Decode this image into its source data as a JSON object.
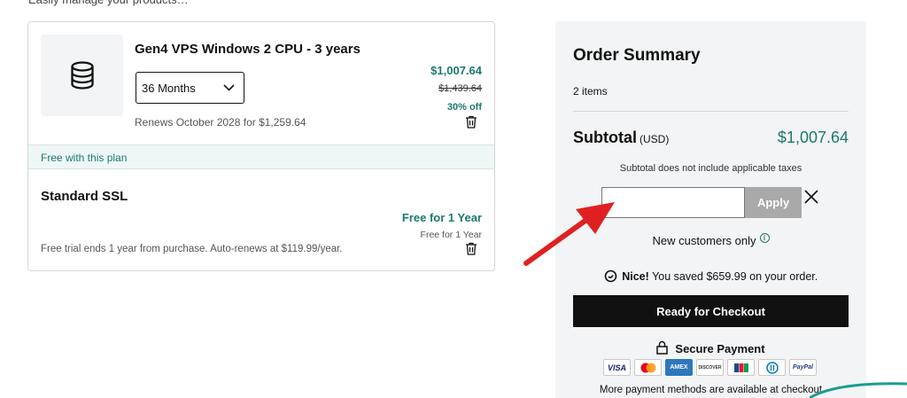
{
  "top_text": "ly … ig … p … … y p…",
  "cart": {
    "product_title": "Gen4 VPS Windows 2 CPU - 3 years",
    "term_value": "36 Months",
    "renews_text": "Renews October 2028 for $1,259.64",
    "price_now": "$1,007.64",
    "price_old": "$1,439.64",
    "discount": "30% off",
    "free_band": "Free with this plan",
    "ssl_title": "Standard SSL",
    "ssl_free": "Free for 1 Year",
    "ssl_free_sub": "Free for 1 Year",
    "ssl_trial": "Free trial ends 1 year from purchase. Auto-renews at $119.99/year."
  },
  "summary": {
    "title": "Order Summary",
    "items": "2 items",
    "subtotal_label": "Subtotal",
    "subtotal_currency": "(USD)",
    "subtotal_value": "$1,007.64",
    "tax_note": "Subtotal does not include applicable taxes",
    "promo_placeholder": "",
    "apply_label": "Apply",
    "new_customers": "New customers only",
    "saved_nice": "Nice!",
    "saved_text": "You saved $659.99 on your order.",
    "checkout_label": "Ready for Checkout",
    "secure_label": "Secure Payment",
    "card_labels": [
      "VISA",
      "",
      "AMEX",
      "DISCOVER",
      "",
      "",
      "PayPal"
    ],
    "more_methods": "More payment methods are available at checkout"
  },
  "icons": {
    "product": "database-icon",
    "dropdown": "chevron-down-icon",
    "delete": "trash-icon",
    "close": "close-icon",
    "info": "info-icon",
    "lock": "lock-icon",
    "savings": "savings-icon",
    "annotation": "red-arrow-annotation"
  },
  "colors": {
    "accent_green": "#1a7a6c",
    "checkout_bg": "#111111",
    "apply_bg": "#a9a9a9",
    "arrow_red": "#e02020"
  }
}
